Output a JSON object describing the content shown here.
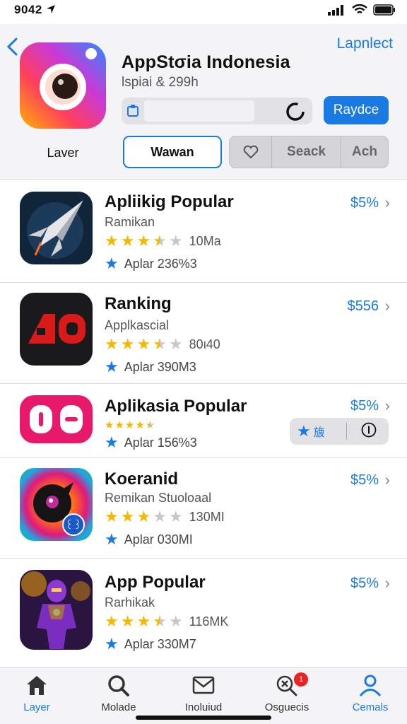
{
  "status_bar": {
    "time": "9042"
  },
  "header": {
    "top_right_link": "Lapnlect",
    "app_title": "AppStσia Indonesia",
    "app_subtitle": "Ɩspiai & 299h",
    "progress": 0.78,
    "action_button": "Raydce",
    "left_label": "Laver",
    "tab_active": "Wawan",
    "segments": [
      "Seack",
      "Ach"
    ]
  },
  "colors": {
    "accent": "#1a7ae3",
    "star": "#f5b800",
    "star_empty": "#c8c8c8"
  },
  "apps": [
    {
      "title": "Apliikig Popular",
      "subtitle": "Ramikan",
      "rating": 3.5,
      "rating_count": "10Ma",
      "aplar": "Aplar 236%3",
      "price": "$5%"
    },
    {
      "title": "Ranking",
      "subtitle": "Applkascial",
      "rating": 3.5,
      "rating_count": "80ι40",
      "aplar": "Aplar 390M3",
      "price": "$556"
    },
    {
      "title": "Aplikasia Popular",
      "subtitle": "",
      "rating": 4.5,
      "rating_count": "",
      "aplar": "Aplar 156%3",
      "price": "$5%",
      "pill_text": "旇"
    },
    {
      "title": "Koeranid",
      "subtitle": "Remikan Stuoloaal",
      "rating": 3,
      "rating_count": "130MI",
      "aplar": "Aplar 030MI",
      "price": "$5%"
    },
    {
      "title": "App Popular",
      "subtitle": "Rarhikak",
      "rating": 3.5,
      "rating_count": "116MK",
      "aplar": "Aplar 330M7",
      "price": "$5%"
    }
  ],
  "tabbar": [
    {
      "label": "Layer",
      "icon": "home-icon",
      "active": true
    },
    {
      "label": "Molade",
      "icon": "search-icon",
      "active": false
    },
    {
      "label": "Inoluiud",
      "icon": "mail-icon",
      "active": false
    },
    {
      "label": "Osguecis",
      "icon": "search-x-icon",
      "active": false,
      "badge": "1"
    },
    {
      "label": "Cemals",
      "icon": "person-icon",
      "active": true
    }
  ]
}
